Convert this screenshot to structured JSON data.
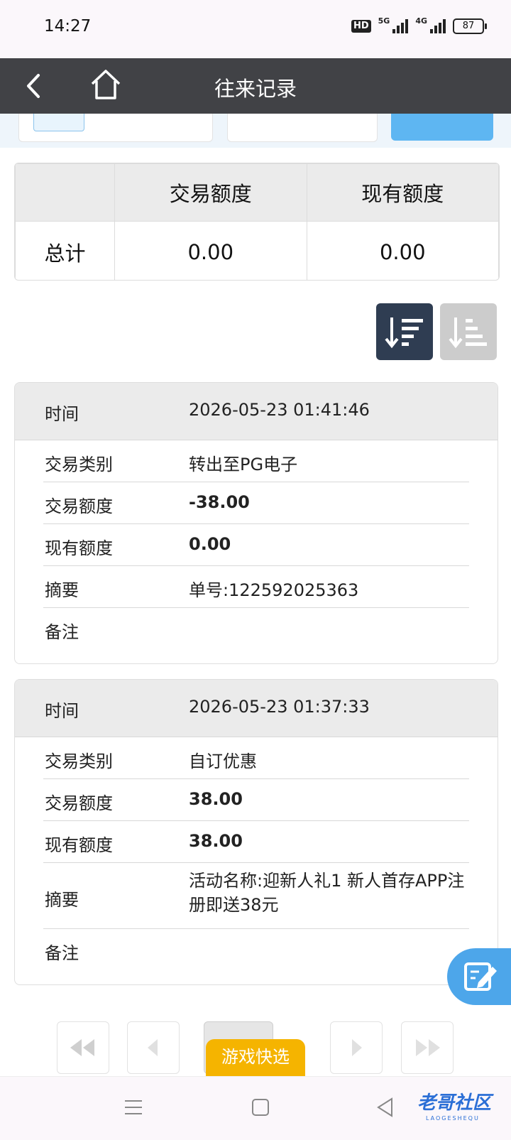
{
  "status": {
    "time": "14:27",
    "hd": "HD",
    "net1": "5G",
    "net2": "4G",
    "battery": "87"
  },
  "header": {
    "title": "往来记录",
    "back_icon": "chevron-left-icon",
    "home_icon": "home-icon"
  },
  "summary": {
    "col1": "交易额度",
    "col2": "现有额度",
    "row_label": "总计",
    "trade": "0.00",
    "current": "0.00"
  },
  "labels": {
    "time": "时间",
    "type": "交易类别",
    "amount": "交易额度",
    "balance": "现有额度",
    "summary": "摘要",
    "remark": "备注"
  },
  "records": [
    {
      "time": "2026-05-23 01:41:46",
      "type": "转出至PG电子",
      "amount": "-38.00",
      "balance": "0.00",
      "summary": "单号:122592025363",
      "remark": ""
    },
    {
      "time": "2026-05-23 01:37:33",
      "type": "自订优惠",
      "amount": "38.00",
      "balance": "38.00",
      "summary": "活动名称:迎新人礼1 新人首存APP注册即送38元",
      "remark": ""
    }
  ],
  "promo": {
    "label": "游戏快选"
  },
  "brand": {
    "name": "老哥社区",
    "sub": "LAOGESHEQU"
  },
  "colors": {
    "nav": "#414246",
    "accent": "#4da6ea",
    "promo": "#f5b400"
  }
}
